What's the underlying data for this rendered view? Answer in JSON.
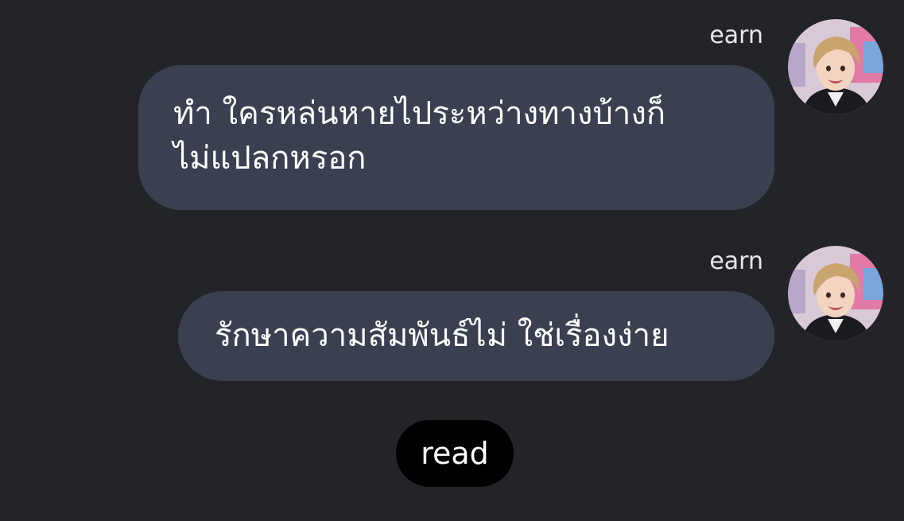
{
  "messages": [
    {
      "sender": "earn",
      "text": "ทำ ใครหล่นหายไประหว่างทางบ้างก็ไม่แปลกหรอก",
      "line1": "ทำ ใครหล่นหายไประหว่างทางบ้างก็",
      "line2": "ไม่แปลกหรอก",
      "avatar": "avatar-photo"
    },
    {
      "sender": "earn",
      "text": "รักษาความสัมพันธ์ไม่ ใช่เรื่องง่าย",
      "avatar": "avatar-photo"
    }
  ],
  "status": {
    "read_label": "read"
  },
  "colors": {
    "background": "#232428",
    "bubble": "#3b4050",
    "read_pill": "#000000",
    "text": "#ffffff"
  }
}
